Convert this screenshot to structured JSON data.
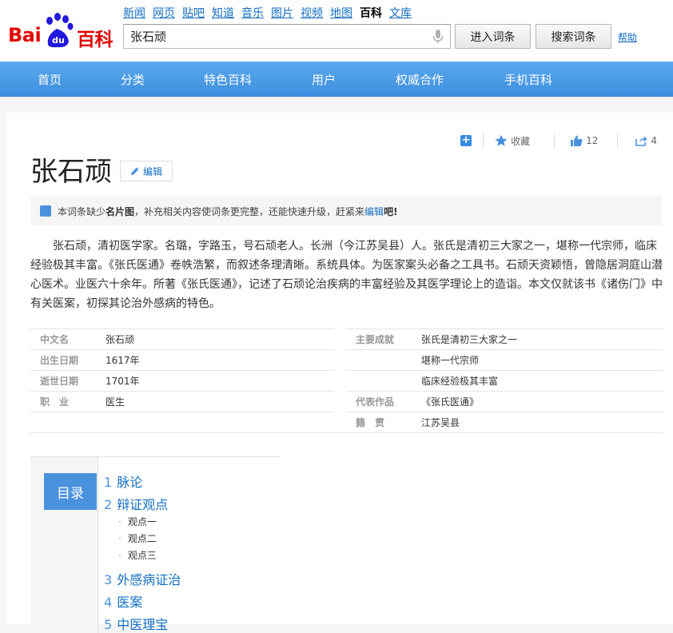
{
  "logo": {
    "bai": "Bai",
    "du": "du",
    "baike": "百科"
  },
  "topnav": [
    "新闻",
    "网页",
    "贴吧",
    "知道",
    "音乐",
    "图片",
    "视频",
    "地图",
    "百科",
    "文库"
  ],
  "topnav_current": "百科",
  "search": {
    "value": "张石顽",
    "enter_label": "进入词条",
    "search_label": "搜索词条",
    "help_label": "帮助"
  },
  "mainnav": [
    "首页",
    "分类",
    "特色百科",
    "用户",
    "权威合作",
    "手机百科"
  ],
  "toolbar": {
    "collect_label": "收藏",
    "like_count": "12",
    "share_count": "4"
  },
  "article": {
    "title": "张石顽",
    "edit_label": "编辑",
    "notice_prefix": "本词条缺少",
    "notice_bold": "名片图",
    "notice_mid": "，补充相关内容使词条更完整，还能快速升级，赶紧来",
    "notice_edit": "编辑",
    "notice_suffix": "吧!",
    "summary": "张石顽，清初医学家。名璐，字路玉，号石顽老人。长洲（今江苏吴县）人。张氏是清初三大家之一，堪称一代宗师，临床经验极其丰富。《张氏医通》卷帙浩繁，而叙述条理清晰。系统具体。为医家案头必备之工具书。石顽天资颖悟，曾隐居洞庭山潜心医术。业医六十余年。所著《张氏医通》，记述了石顽论治疾病的丰富经验及其医学理论上的造诣。本文仅就该书《诸伤门》中有关医案，初探其论治外感病的特色。"
  },
  "basic_info": {
    "left": [
      {
        "k": "中文名",
        "v": "张石顽"
      },
      {
        "k": "出生日期",
        "v": "1617年"
      },
      {
        "k": "逝世日期",
        "v": "1701年"
      },
      {
        "k": "职　业",
        "v": "医生"
      }
    ],
    "right": [
      {
        "k": "主要成就",
        "v": "张氏是清初三大家之一"
      },
      {
        "k": "",
        "v": "堪称一代宗师"
      },
      {
        "k": "",
        "v": "临床经验极其丰富"
      },
      {
        "k": "代表作品",
        "v": "《张氏医通》"
      },
      {
        "k": "籍　贯",
        "v": "江苏吴县"
      }
    ]
  },
  "toc": {
    "title": "目录",
    "items": [
      {
        "num": "1",
        "label": "脉论"
      },
      {
        "num": "2",
        "label": "辩证观点"
      },
      {
        "num": "3",
        "label": "外感病证治"
      },
      {
        "num": "4",
        "label": "医案"
      },
      {
        "num": "5",
        "label": "中医理宝"
      }
    ],
    "subitems": [
      "观点一",
      "观点二",
      "观点三"
    ]
  },
  "colors": {
    "brand_red": "#e10602",
    "brand_blue": "#2319dc",
    "nav_blue": "#4b92de",
    "link": "#136ec2"
  }
}
